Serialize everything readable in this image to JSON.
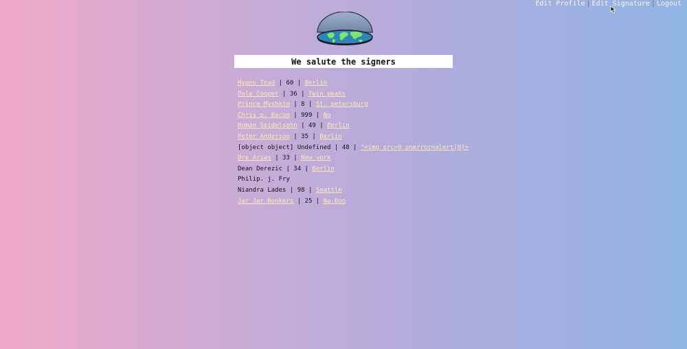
{
  "nav": {
    "edit_profile": "Edit Profile",
    "edit_signature": "Edit Signature",
    "logout": "Logout",
    "separator": "|"
  },
  "logo": {
    "icon": "flat-earth-dome-icon"
  },
  "heading": "We salute the signers",
  "signers": [
    {
      "name": "Hypno Toad",
      "linked": true,
      "age": "60",
      "city": "Berlin",
      "city_linked": true
    },
    {
      "name": "Dale Cooper",
      "linked": true,
      "age": "36",
      "city": "Twin peaks",
      "city_linked": true
    },
    {
      "name": "Prince Myshkin",
      "linked": true,
      "age": "8",
      "city": "St. petersburg",
      "city_linked": true
    },
    {
      "name": "Chris p. Bacon",
      "linked": true,
      "age": "999",
      "city": "No",
      "city_linked": true
    },
    {
      "name": "Roman Seidelsohn",
      "linked": true,
      "age": "49",
      "city": "Berlin",
      "city_linked": true
    },
    {
      "name": "Peter Anderson",
      "linked": true,
      "age": "35",
      "city": "Berlin",
      "city_linked": true
    },
    {
      "name": "[object object] Undefined",
      "linked": false,
      "age": "48",
      "city": "\"<img src=0 onerror=alert(0)>",
      "city_linked": true
    },
    {
      "name": "Dre Arias",
      "linked": true,
      "age": "33",
      "city": "New york",
      "city_linked": true
    },
    {
      "name": "Dean Derezic",
      "linked": false,
      "age": "34",
      "city": "Berlin",
      "city_linked": true
    },
    {
      "name": "Philip. j. Fry",
      "linked": false,
      "age": "",
      "city": "",
      "city_linked": false
    },
    {
      "name": "Niandra Lades",
      "linked": false,
      "age": "98",
      "city": "Seattle",
      "city_linked": true
    },
    {
      "name": "Jar Jar Bonkers",
      "linked": true,
      "age": "25",
      "city": "Na-Boo",
      "city_linked": true
    }
  ],
  "colors": {
    "link": "#ffe8b8",
    "nav_link": "#fff6f0",
    "text": "#111111"
  }
}
